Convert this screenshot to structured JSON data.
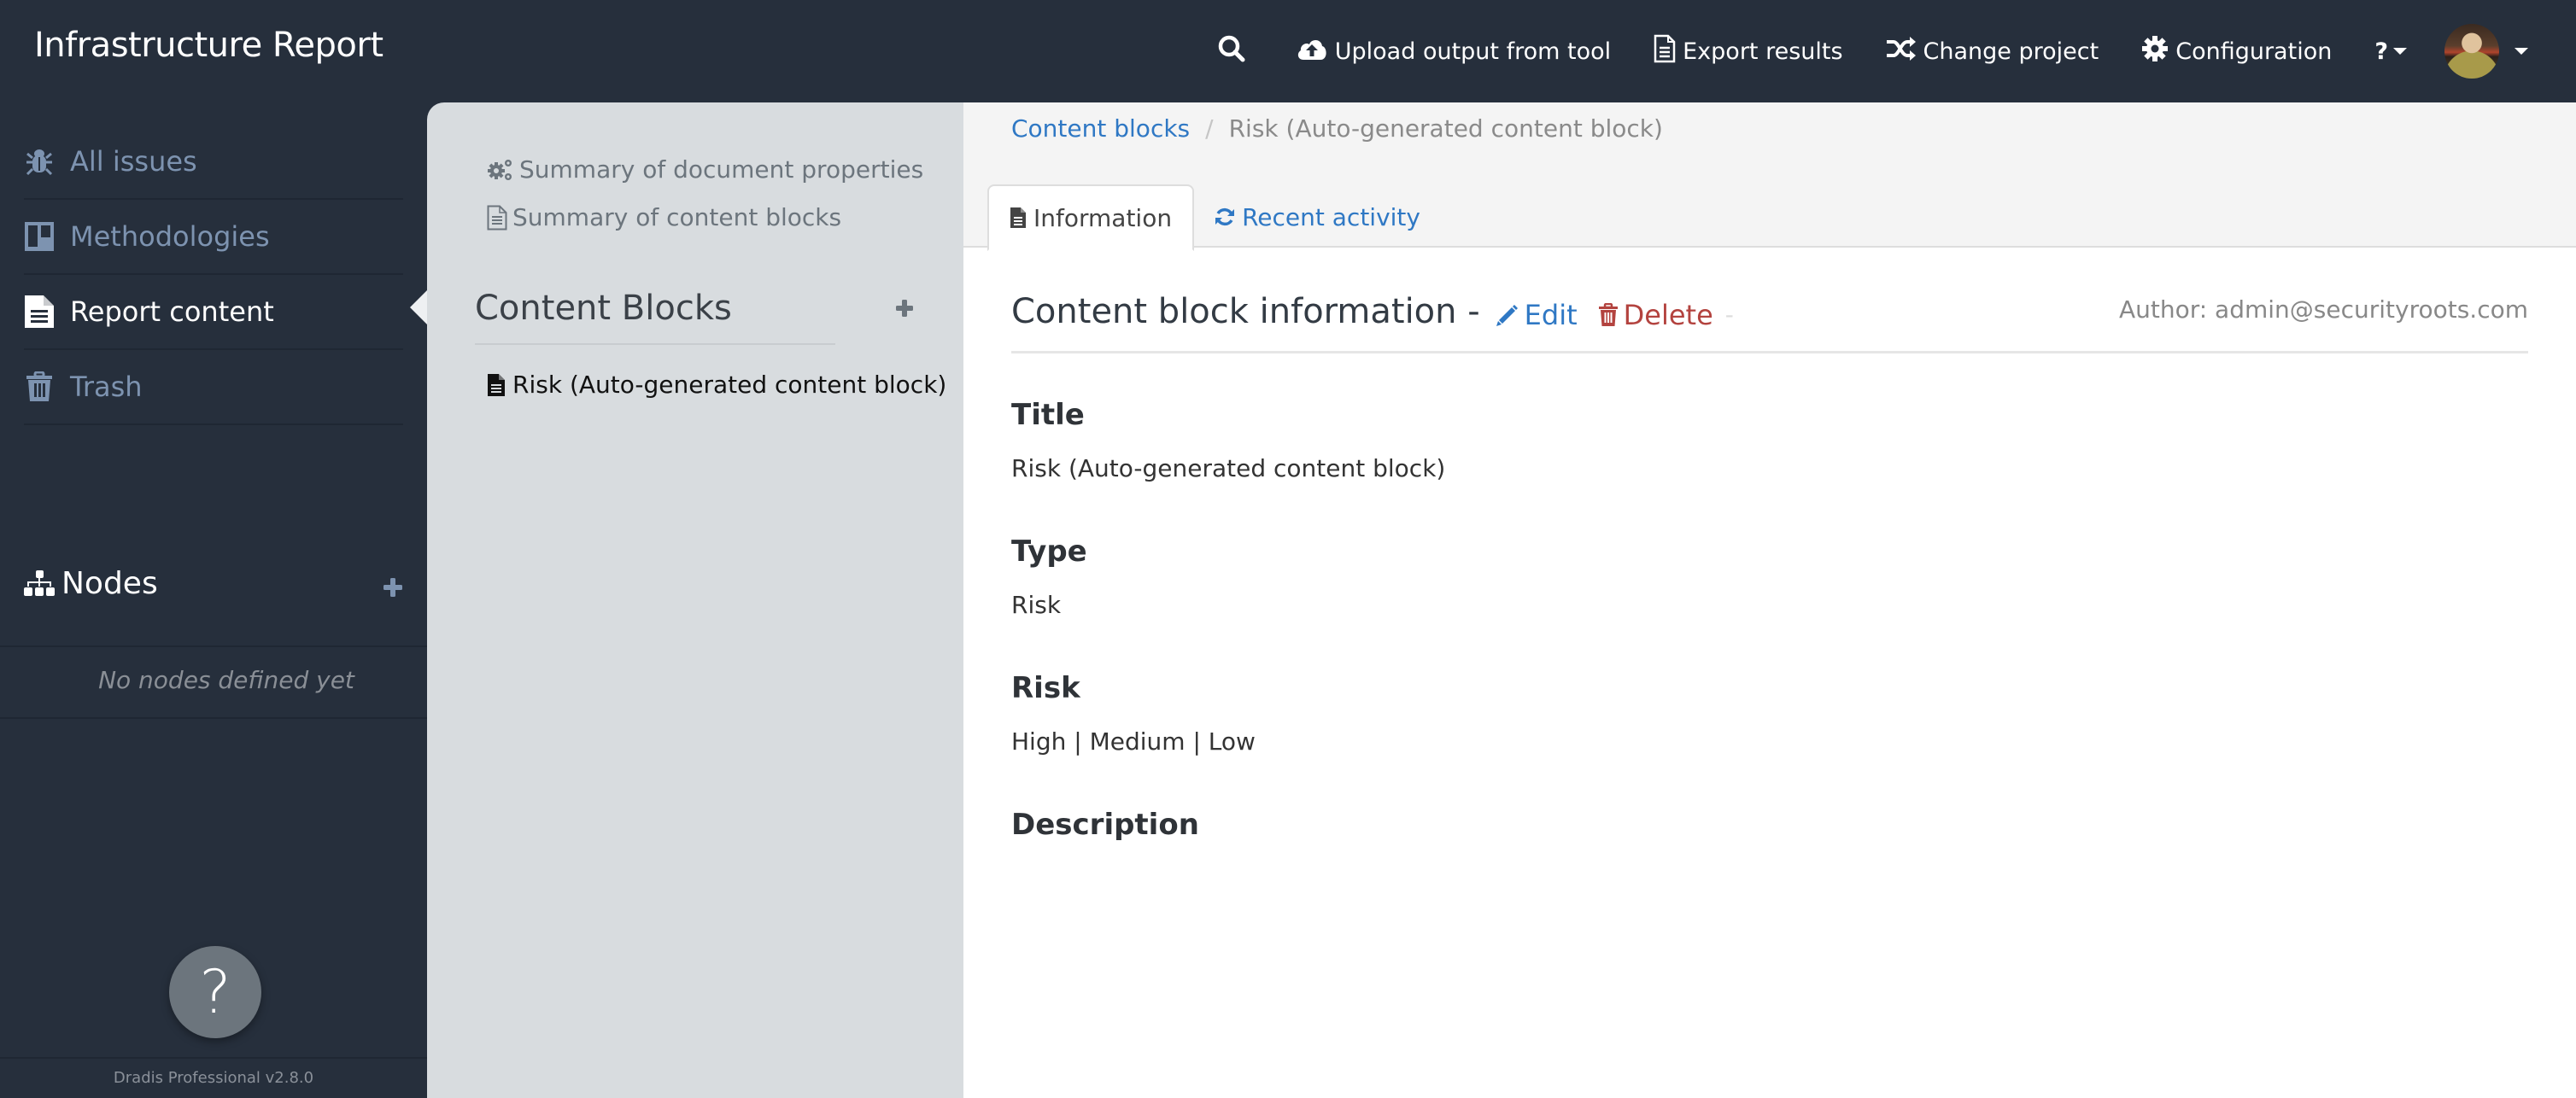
{
  "app": {
    "title": "Infrastructure Report"
  },
  "topnav": {
    "search_icon": "search-icon",
    "items": [
      {
        "label": "Upload output from tool",
        "icon": "cloud-upload-icon"
      },
      {
        "label": "Export results",
        "icon": "file-text-icon"
      },
      {
        "label": "Change project",
        "icon": "random-icon"
      },
      {
        "label": "Configuration",
        "icon": "gear-icon"
      }
    ],
    "help_label": "?",
    "user_avatar": "user-avatar"
  },
  "sidebar": {
    "items": [
      {
        "label": "All issues",
        "icon": "bug-icon",
        "active": false
      },
      {
        "label": "Methodologies",
        "icon": "board-icon",
        "active": false
      },
      {
        "label": "Report content",
        "icon": "file-icon",
        "active": true
      },
      {
        "label": "Trash",
        "icon": "trash-icon",
        "active": false
      }
    ],
    "nodes": {
      "title": "Nodes",
      "icon": "sitemap-icon",
      "empty_text": "No nodes defined yet"
    },
    "help_button": "?",
    "version": "Dradis Professional v2.8.0"
  },
  "middle": {
    "links": [
      {
        "label": "Summary of document properties",
        "icon": "gears-icon"
      },
      {
        "label": "Summary of content blocks",
        "icon": "file-outline-icon"
      }
    ],
    "section_title": "Content Blocks",
    "items": [
      {
        "label": "Risk (Auto-generated content block)",
        "icon": "file-icon"
      }
    ]
  },
  "content": {
    "breadcrumb": {
      "parent": "Content blocks",
      "separator": "/",
      "current": "Risk (Auto-generated content block)"
    },
    "tabs": [
      {
        "label": "Information",
        "icon": "file-icon",
        "active": true
      },
      {
        "label": "Recent activity",
        "icon": "refresh-icon",
        "active": false
      }
    ],
    "header": {
      "title": "Content block information -",
      "edit_label": "Edit",
      "delete_label": "Delete",
      "trailing": "-",
      "author": "Author: admin@securityroots.com"
    },
    "fields": [
      {
        "label": "Title",
        "value": "Risk (Auto-generated content block)"
      },
      {
        "label": "Type",
        "value": "Risk"
      },
      {
        "label": "Risk",
        "value": "High | Medium | Low"
      },
      {
        "label": "Description",
        "value": ""
      }
    ]
  },
  "colors": {
    "navbar_bg": "#262f3c",
    "middle_panel_bg": "#d8dcdf",
    "link_blue": "#2f78c4",
    "delete_red": "#b3433f",
    "sidebar_inactive": "#7d93b0"
  }
}
